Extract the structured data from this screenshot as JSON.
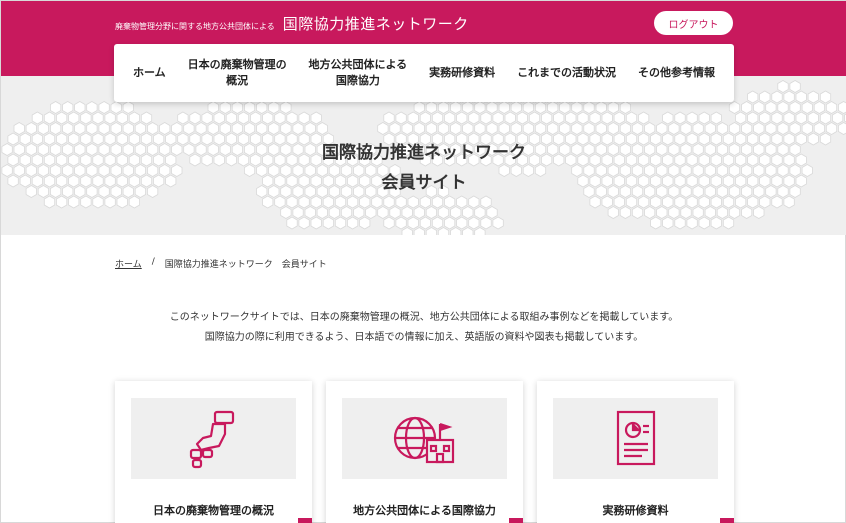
{
  "header": {
    "subtitle": "廃棄物管理分野に関する地方公共団体による",
    "title": "国際協力推進ネットワーク",
    "logout_label": "ログアウト"
  },
  "nav": {
    "items": [
      {
        "label": "ホーム"
      },
      {
        "label": "日本の廃棄物管理の\n概況"
      },
      {
        "label": "地方公共団体による\n国際協力"
      },
      {
        "label": "実務研修資料"
      },
      {
        "label": "これまでの活動状況"
      },
      {
        "label": "その他参考情報"
      }
    ]
  },
  "hero": {
    "title": "国際協力推進ネットワーク\n会員サイト"
  },
  "breadcrumb": {
    "home": "ホーム",
    "separator": "/",
    "current": "国際協力推進ネットワーク　会員サイト"
  },
  "intro": {
    "line1": "このネットワークサイトでは、日本の廃棄物管理の概況、地方公共団体による取組み事例などを掲載しています。",
    "line2": "国際協力の際に利用できるよう、日本語での情報に加え、英語版の資料や図表も掲載しています。"
  },
  "cards": [
    {
      "label": "日本の廃棄物管理の概況",
      "icon": "japan-map-icon"
    },
    {
      "label": "地方公共団体による国際協力",
      "icon": "globe-building-icon"
    },
    {
      "label": "実務研修資料",
      "icon": "document-chart-icon"
    }
  ],
  "colors": {
    "brand": "#c8195d",
    "hero_bg": "#efefef",
    "card_img_bg": "#efefef",
    "text": "#222222"
  }
}
